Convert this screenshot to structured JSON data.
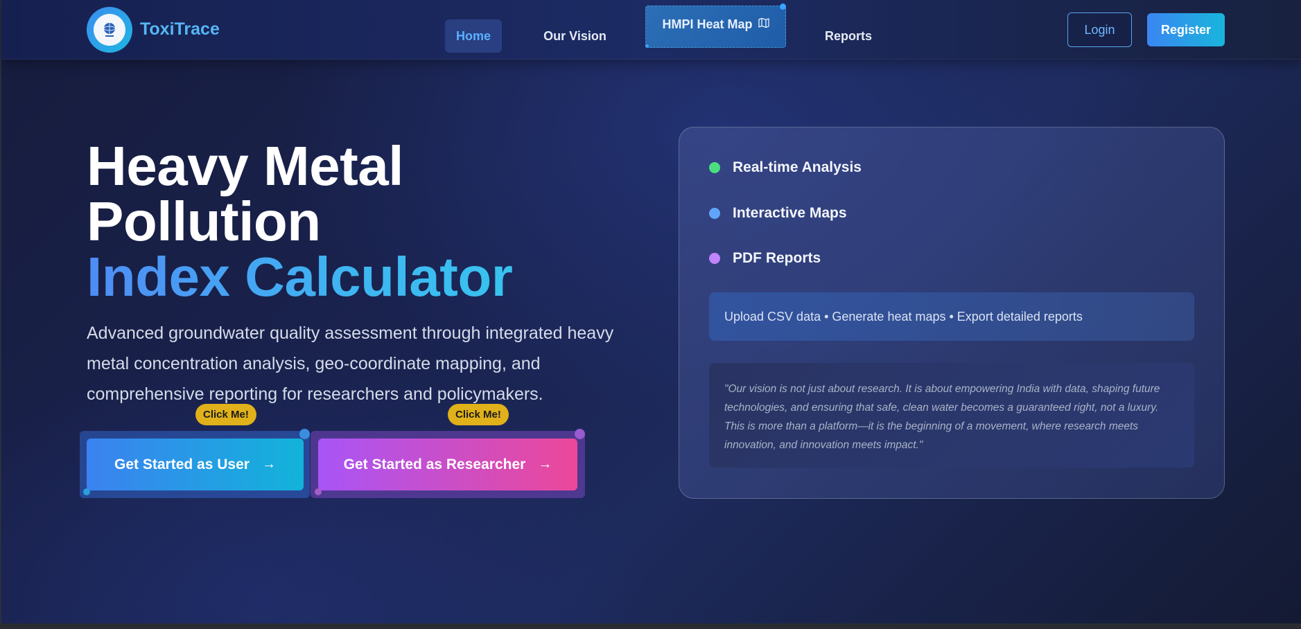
{
  "nav": {
    "brand": "ToxiTrace",
    "links": {
      "home": "Home",
      "vision": "Our Vision",
      "hmpi": "HMPI Heat Map",
      "reports": "Reports"
    },
    "login": "Login",
    "register": "Register"
  },
  "hero": {
    "title_line1": "Heavy Metal",
    "title_line2": "Pollution",
    "title_line3": "Index Calculator",
    "description": "Advanced groundwater quality assessment through integrated heavy metal concentration analysis, geo-coordinate mapping, and comprehensive reporting for researchers and policymakers.",
    "cta_user": "Get Started as User",
    "cta_researcher": "Get Started as Researcher",
    "click_tag": "Click Me!"
  },
  "card": {
    "features": [
      {
        "label": "Real-time Analysis",
        "color": "#4ade80"
      },
      {
        "label": "Interactive Maps",
        "color": "#60a5fa"
      },
      {
        "label": "PDF Reports",
        "color": "#c084fc"
      }
    ],
    "upload_text": "Upload CSV data • Generate heat maps • Export detailed reports",
    "quote": "\"Our vision is not just about research. It is about empowering India with data, shaping future technologies, and ensuring that safe, clean water becomes a guaranteed right, not a luxury. This is more than a platform—it is the beginning of a movement, where research meets innovation, and innovation meets impact.\""
  },
  "colors": {
    "accent_blue": "#3b82f0",
    "accent_cyan": "#12b3da",
    "accent_purple": "#a855f7",
    "accent_pink": "#ec4899",
    "tag_yellow": "#e0b11a"
  }
}
